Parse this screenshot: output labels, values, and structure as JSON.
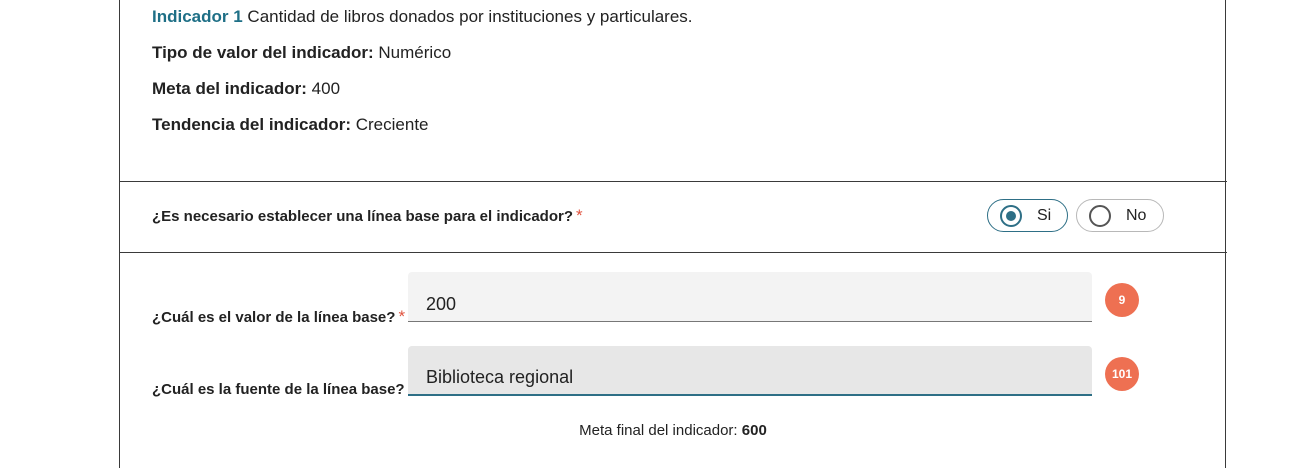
{
  "indicator": {
    "label": "Indicador 1",
    "description": "Cantidad de libros donados por instituciones y particulares.",
    "value_type_label": "Tipo de valor del indicador:",
    "value_type": "Numérico",
    "goal_label": "Meta del indicador:",
    "goal": "400",
    "trend_label": "Tendencia del indicador:",
    "trend": "Creciente"
  },
  "baseline_question": {
    "text": "¿Es necesario establecer una línea base para el indicador?",
    "required_mark": "*",
    "options": [
      "Si",
      "No"
    ],
    "selected": "Si"
  },
  "baseline_value": {
    "label": "¿Cuál es el valor de la línea base?",
    "required_mark": "*",
    "value": "200",
    "badge": "9"
  },
  "baseline_source": {
    "label": "¿Cuál es la fuente de la línea base?",
    "value": "Biblioteca regional",
    "badge": "101"
  },
  "final_goal": {
    "label": "Meta final del indicador:",
    "value": "600"
  },
  "colors": {
    "accent": "#2e6f86",
    "indicator_label": "#1e6f86",
    "badge": "#ee7052",
    "required": "#e0533f"
  }
}
